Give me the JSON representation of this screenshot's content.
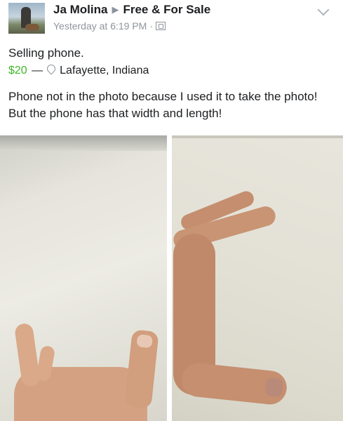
{
  "post": {
    "author": "Ja Molina",
    "group": "Free & For Sale",
    "timestamp": "Yesterday at 6:19 PM",
    "separator": "·"
  },
  "listing": {
    "title": "Selling phone.",
    "price": "$20",
    "dash": "—",
    "location": "Lafayette, Indiana",
    "description": "Phone not in the photo because I used it to take the photo! But the phone has that width and length!"
  },
  "icons": {
    "arrow": "triangle-right-icon",
    "audience": "group-audience-icon",
    "location": "map-pin-icon",
    "menu": "chevron-down-icon"
  },
  "colors": {
    "price": "#42b72a",
    "meta_text": "#90949c"
  }
}
